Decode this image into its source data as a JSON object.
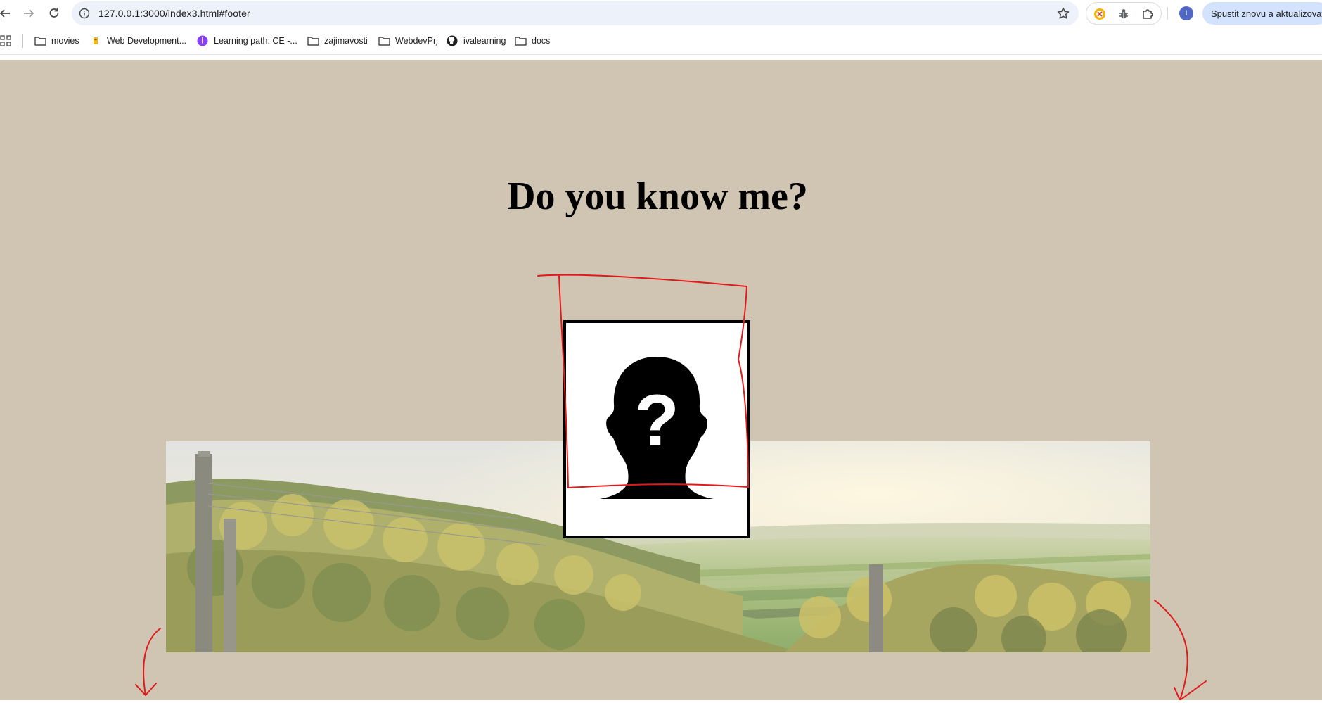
{
  "browser": {
    "url": "127.0.0.1:3000/index3.html#footer",
    "update_button_label": "Spustit znovu a aktualizovat",
    "profile_initial": "I",
    "icons": [
      "back-icon",
      "forward-icon",
      "reload-icon",
      "site-info-icon",
      "bookmark-star-icon",
      "extension-icon",
      "bug-icon",
      "puzzle-icon",
      "profile-avatar"
    ]
  },
  "bookmarks": [
    {
      "label": "movies",
      "icon": "folder-icon"
    },
    {
      "label": "Web Development...",
      "icon": "site-favicon"
    },
    {
      "label": "Learning path: CE -...",
      "icon": "learning-favicon"
    },
    {
      "label": "zajimavosti",
      "icon": "folder-icon"
    },
    {
      "label": "WebdevPrj",
      "icon": "folder-icon"
    },
    {
      "label": "ivalearning",
      "icon": "github-icon"
    },
    {
      "label": "docs",
      "icon": "folder-icon"
    }
  ],
  "page": {
    "title": "Do you know me?",
    "background_color": "#d0c5b2",
    "portrait_icon": "unknown-person-silhouette-icon",
    "banner_image": "vineyard-landscape",
    "annotation_color": "#e0191b"
  }
}
